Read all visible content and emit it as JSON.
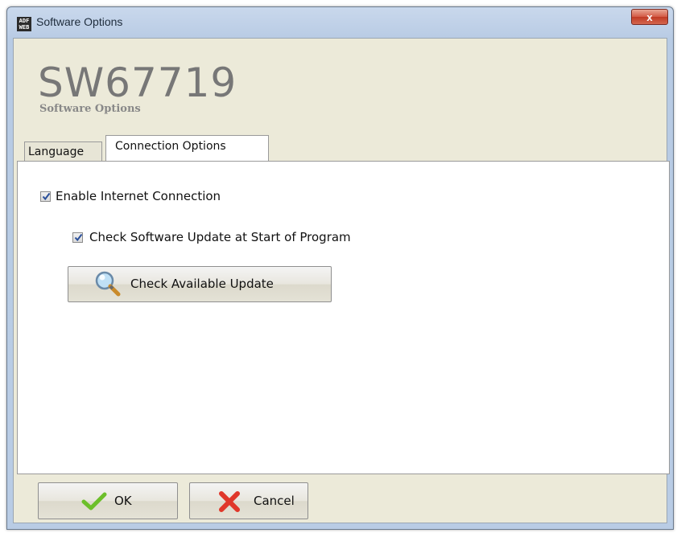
{
  "window": {
    "title": "Software Options",
    "icon_text": "ADF WEB",
    "close_label": "x"
  },
  "header": {
    "product_code": "SW67719",
    "subtitle": "Software Options"
  },
  "tabs": [
    {
      "label": "Language",
      "active": false
    },
    {
      "label": "Connection Options",
      "active": true
    }
  ],
  "connection": {
    "enable_internet": {
      "label": "Enable Internet Connection",
      "checked": true
    },
    "check_update_on_start": {
      "label": "Check Software Update at Start of Program",
      "checked": true
    },
    "check_update_button": {
      "label": "Check Available Update",
      "icon": "magnifier-icon"
    }
  },
  "footer": {
    "ok_label": "OK",
    "ok_icon": "checkmark-icon",
    "cancel_label": "Cancel",
    "cancel_icon": "cross-icon"
  },
  "colors": {
    "title_bar": "#b9cce5",
    "dialog_bg": "#ecead9",
    "panel_bg": "#ffffff",
    "close_button": "#c9432c",
    "ok_check": "#6cbf2a",
    "cancel_cross": "#e0372a"
  }
}
